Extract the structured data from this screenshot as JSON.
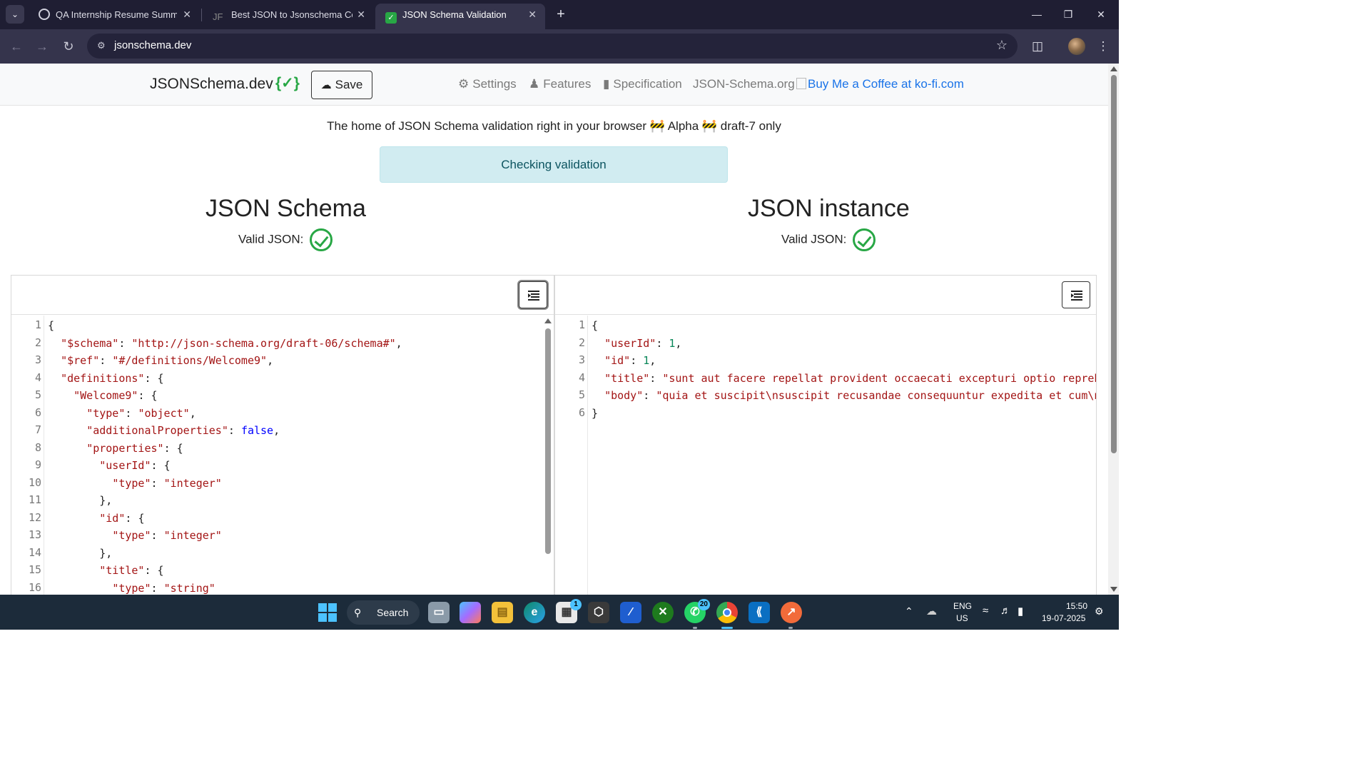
{
  "browser": {
    "tabs": [
      {
        "label": "QA Internship Resume Summar",
        "active": false
      },
      {
        "label": "Best JSON to Jsonschema Conv",
        "active": false
      },
      {
        "label": "JSON Schema Validation",
        "active": true
      }
    ],
    "address": "jsonschema.dev"
  },
  "navbar": {
    "brand": "JSONSchema.dev",
    "brand_badge": "{✓}",
    "save_label": "Save",
    "links": {
      "settings": "Settings",
      "features": "Features",
      "specification": "Specification",
      "jsonschema_org": "JSON-Schema.org",
      "kofi": "Buy Me a Coffee at ko-fi.com"
    }
  },
  "tagline": "The home of JSON Schema validation right in your browser 🚧 Alpha 🚧 draft-7 only",
  "alert": "Checking validation",
  "schema_panel": {
    "title": "JSON Schema",
    "valid_label": "Valid JSON:",
    "line_numbers": [
      "1",
      "2",
      "3",
      "4",
      "5",
      "6",
      "7",
      "8",
      "9",
      "10",
      "11",
      "12",
      "13",
      "14",
      "15",
      "16"
    ],
    "lines": [
      "{",
      "  \"$schema\": \"http://json-schema.org/draft-06/schema#\",",
      "  \"$ref\": \"#/definitions/Welcome9\",",
      "  \"definitions\": {",
      "    \"Welcome9\": {",
      "      \"type\": \"object\",",
      "      \"additionalProperties\": false,",
      "      \"properties\": {",
      "        \"userId\": {",
      "          \"type\": \"integer\"",
      "        },",
      "        \"id\": {",
      "          \"type\": \"integer\"",
      "        },",
      "        \"title\": {",
      "          \"type\": \"string\""
    ]
  },
  "instance_panel": {
    "title": "JSON instance",
    "valid_label": "Valid JSON:",
    "line_numbers": [
      "1",
      "2",
      "3",
      "4",
      "5",
      "6"
    ],
    "lines": [
      "{",
      "  \"userId\": 1,",
      "  \"id\": 1,",
      "  \"title\": \"sunt aut facere repellat provident occaecati excepturi optio repreh",
      "  \"body\": \"quia et suscipit\\nsuscipit recusandae consequuntur expedita et cum\\n",
      "}"
    ]
  },
  "taskbar": {
    "search_label": "Search",
    "lang_top": "ENG",
    "lang_bottom": "US",
    "time": "15:50",
    "date": "19-07-2025",
    "store_badge": "1",
    "whatsapp_badge": "20"
  },
  "colors": {
    "accent_green": "#28a745",
    "alert_bg": "#d1ecf1",
    "alert_text": "#0c5460",
    "string_color": "#a31515",
    "number_color": "#098658",
    "keyword_color": "#0000ff"
  }
}
